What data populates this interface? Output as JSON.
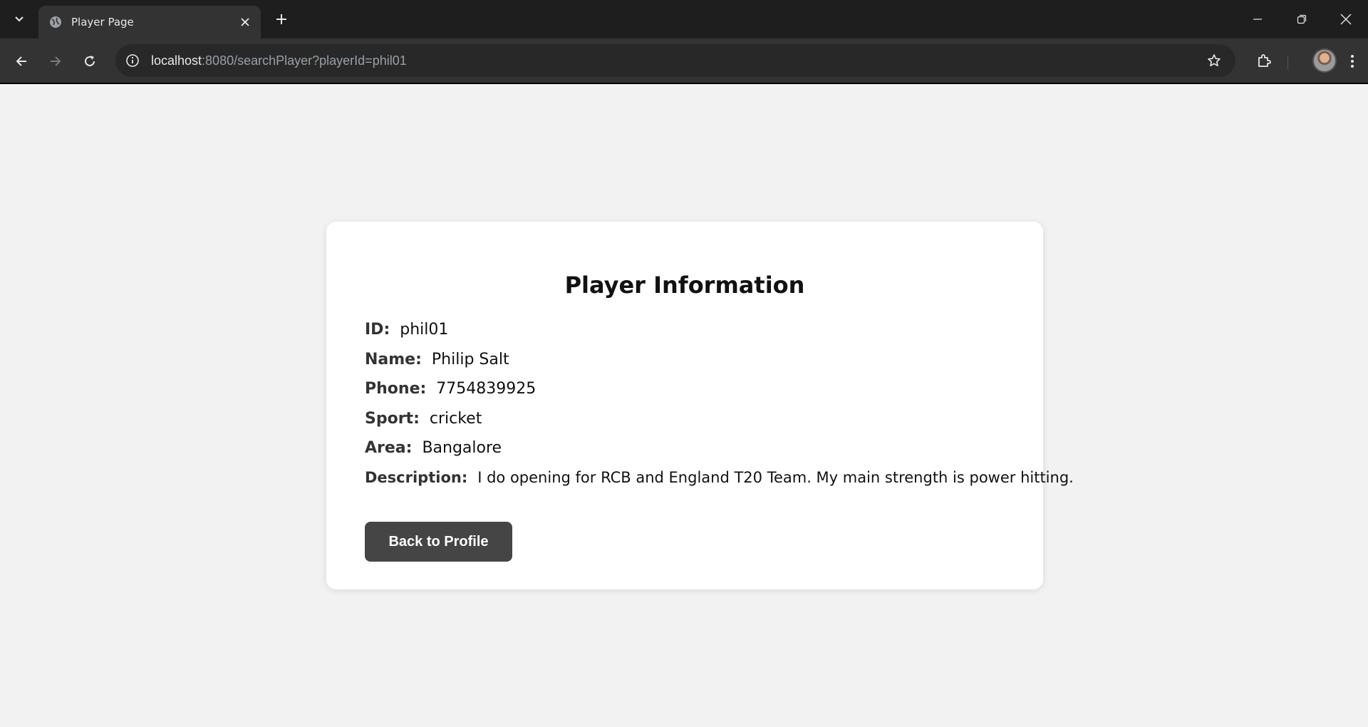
{
  "browser": {
    "tab_title": "Player Page",
    "url_host": "localhost",
    "url_rest": ":8080/searchPlayer?playerId=phil01"
  },
  "card": {
    "title": "Player Information",
    "fields": [
      {
        "label": "ID:",
        "value": "phil01"
      },
      {
        "label": "Name:",
        "value": "Philip Salt"
      },
      {
        "label": "Phone:",
        "value": "7754839925"
      },
      {
        "label": "Sport:",
        "value": "cricket"
      },
      {
        "label": "Area:",
        "value": "Bangalore"
      },
      {
        "label": "Description:",
        "value": "I do opening for RCB and England T20 Team. My main strength is power hitting."
      }
    ],
    "back_button": "Back to Profile"
  },
  "colors": {
    "page_bg": "#f2f2f2",
    "button_bg": "#454545",
    "chrome_bg": "#1e1e1e"
  },
  "icons": [
    "chevron-down-icon",
    "globe-icon",
    "close-icon",
    "plus-icon",
    "minimize-icon",
    "restore-icon",
    "back-arrow-icon",
    "forward-arrow-icon",
    "reload-icon",
    "info-icon",
    "star-icon",
    "puzzle-icon",
    "kebab-menu-icon"
  ]
}
